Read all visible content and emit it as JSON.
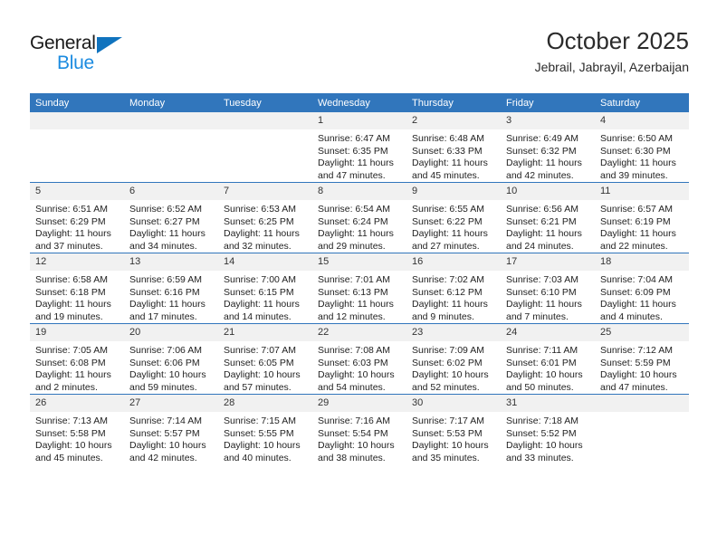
{
  "brand": {
    "name_part1": "General",
    "name_part2": "Blue",
    "accent_color": "#1073BE",
    "blue_text_color": "#1B8BE0"
  },
  "header": {
    "title": "October 2025",
    "subtitle": "Jebrail, Jabrayil, Azerbaijan"
  },
  "theme": {
    "header_blue": "#3176BC",
    "daynum_band": "#F1F1F1"
  },
  "weekdays": [
    "Sunday",
    "Monday",
    "Tuesday",
    "Wednesday",
    "Thursday",
    "Friday",
    "Saturday"
  ],
  "weeks": [
    [
      {
        "day": "",
        "sunrise": "",
        "sunset": "",
        "daylight1": "",
        "daylight2": ""
      },
      {
        "day": "",
        "sunrise": "",
        "sunset": "",
        "daylight1": "",
        "daylight2": ""
      },
      {
        "day": "",
        "sunrise": "",
        "sunset": "",
        "daylight1": "",
        "daylight2": ""
      },
      {
        "day": "1",
        "sunrise": "Sunrise: 6:47 AM",
        "sunset": "Sunset: 6:35 PM",
        "daylight1": "Daylight: 11 hours",
        "daylight2": "and 47 minutes."
      },
      {
        "day": "2",
        "sunrise": "Sunrise: 6:48 AM",
        "sunset": "Sunset: 6:33 PM",
        "daylight1": "Daylight: 11 hours",
        "daylight2": "and 45 minutes."
      },
      {
        "day": "3",
        "sunrise": "Sunrise: 6:49 AM",
        "sunset": "Sunset: 6:32 PM",
        "daylight1": "Daylight: 11 hours",
        "daylight2": "and 42 minutes."
      },
      {
        "day": "4",
        "sunrise": "Sunrise: 6:50 AM",
        "sunset": "Sunset: 6:30 PM",
        "daylight1": "Daylight: 11 hours",
        "daylight2": "and 39 minutes."
      }
    ],
    [
      {
        "day": "5",
        "sunrise": "Sunrise: 6:51 AM",
        "sunset": "Sunset: 6:29 PM",
        "daylight1": "Daylight: 11 hours",
        "daylight2": "and 37 minutes."
      },
      {
        "day": "6",
        "sunrise": "Sunrise: 6:52 AM",
        "sunset": "Sunset: 6:27 PM",
        "daylight1": "Daylight: 11 hours",
        "daylight2": "and 34 minutes."
      },
      {
        "day": "7",
        "sunrise": "Sunrise: 6:53 AM",
        "sunset": "Sunset: 6:25 PM",
        "daylight1": "Daylight: 11 hours",
        "daylight2": "and 32 minutes."
      },
      {
        "day": "8",
        "sunrise": "Sunrise: 6:54 AM",
        "sunset": "Sunset: 6:24 PM",
        "daylight1": "Daylight: 11 hours",
        "daylight2": "and 29 minutes."
      },
      {
        "day": "9",
        "sunrise": "Sunrise: 6:55 AM",
        "sunset": "Sunset: 6:22 PM",
        "daylight1": "Daylight: 11 hours",
        "daylight2": "and 27 minutes."
      },
      {
        "day": "10",
        "sunrise": "Sunrise: 6:56 AM",
        "sunset": "Sunset: 6:21 PM",
        "daylight1": "Daylight: 11 hours",
        "daylight2": "and 24 minutes."
      },
      {
        "day": "11",
        "sunrise": "Sunrise: 6:57 AM",
        "sunset": "Sunset: 6:19 PM",
        "daylight1": "Daylight: 11 hours",
        "daylight2": "and 22 minutes."
      }
    ],
    [
      {
        "day": "12",
        "sunrise": "Sunrise: 6:58 AM",
        "sunset": "Sunset: 6:18 PM",
        "daylight1": "Daylight: 11 hours",
        "daylight2": "and 19 minutes."
      },
      {
        "day": "13",
        "sunrise": "Sunrise: 6:59 AM",
        "sunset": "Sunset: 6:16 PM",
        "daylight1": "Daylight: 11 hours",
        "daylight2": "and 17 minutes."
      },
      {
        "day": "14",
        "sunrise": "Sunrise: 7:00 AM",
        "sunset": "Sunset: 6:15 PM",
        "daylight1": "Daylight: 11 hours",
        "daylight2": "and 14 minutes."
      },
      {
        "day": "15",
        "sunrise": "Sunrise: 7:01 AM",
        "sunset": "Sunset: 6:13 PM",
        "daylight1": "Daylight: 11 hours",
        "daylight2": "and 12 minutes."
      },
      {
        "day": "16",
        "sunrise": "Sunrise: 7:02 AM",
        "sunset": "Sunset: 6:12 PM",
        "daylight1": "Daylight: 11 hours",
        "daylight2": "and 9 minutes."
      },
      {
        "day": "17",
        "sunrise": "Sunrise: 7:03 AM",
        "sunset": "Sunset: 6:10 PM",
        "daylight1": "Daylight: 11 hours",
        "daylight2": "and 7 minutes."
      },
      {
        "day": "18",
        "sunrise": "Sunrise: 7:04 AM",
        "sunset": "Sunset: 6:09 PM",
        "daylight1": "Daylight: 11 hours",
        "daylight2": "and 4 minutes."
      }
    ],
    [
      {
        "day": "19",
        "sunrise": "Sunrise: 7:05 AM",
        "sunset": "Sunset: 6:08 PM",
        "daylight1": "Daylight: 11 hours",
        "daylight2": "and 2 minutes."
      },
      {
        "day": "20",
        "sunrise": "Sunrise: 7:06 AM",
        "sunset": "Sunset: 6:06 PM",
        "daylight1": "Daylight: 10 hours",
        "daylight2": "and 59 minutes."
      },
      {
        "day": "21",
        "sunrise": "Sunrise: 7:07 AM",
        "sunset": "Sunset: 6:05 PM",
        "daylight1": "Daylight: 10 hours",
        "daylight2": "and 57 minutes."
      },
      {
        "day": "22",
        "sunrise": "Sunrise: 7:08 AM",
        "sunset": "Sunset: 6:03 PM",
        "daylight1": "Daylight: 10 hours",
        "daylight2": "and 54 minutes."
      },
      {
        "day": "23",
        "sunrise": "Sunrise: 7:09 AM",
        "sunset": "Sunset: 6:02 PM",
        "daylight1": "Daylight: 10 hours",
        "daylight2": "and 52 minutes."
      },
      {
        "day": "24",
        "sunrise": "Sunrise: 7:11 AM",
        "sunset": "Sunset: 6:01 PM",
        "daylight1": "Daylight: 10 hours",
        "daylight2": "and 50 minutes."
      },
      {
        "day": "25",
        "sunrise": "Sunrise: 7:12 AM",
        "sunset": "Sunset: 5:59 PM",
        "daylight1": "Daylight: 10 hours",
        "daylight2": "and 47 minutes."
      }
    ],
    [
      {
        "day": "26",
        "sunrise": "Sunrise: 7:13 AM",
        "sunset": "Sunset: 5:58 PM",
        "daylight1": "Daylight: 10 hours",
        "daylight2": "and 45 minutes."
      },
      {
        "day": "27",
        "sunrise": "Sunrise: 7:14 AM",
        "sunset": "Sunset: 5:57 PM",
        "daylight1": "Daylight: 10 hours",
        "daylight2": "and 42 minutes."
      },
      {
        "day": "28",
        "sunrise": "Sunrise: 7:15 AM",
        "sunset": "Sunset: 5:55 PM",
        "daylight1": "Daylight: 10 hours",
        "daylight2": "and 40 minutes."
      },
      {
        "day": "29",
        "sunrise": "Sunrise: 7:16 AM",
        "sunset": "Sunset: 5:54 PM",
        "daylight1": "Daylight: 10 hours",
        "daylight2": "and 38 minutes."
      },
      {
        "day": "30",
        "sunrise": "Sunrise: 7:17 AM",
        "sunset": "Sunset: 5:53 PM",
        "daylight1": "Daylight: 10 hours",
        "daylight2": "and 35 minutes."
      },
      {
        "day": "31",
        "sunrise": "Sunrise: 7:18 AM",
        "sunset": "Sunset: 5:52 PM",
        "daylight1": "Daylight: 10 hours",
        "daylight2": "and 33 minutes."
      },
      {
        "day": "",
        "sunrise": "",
        "sunset": "",
        "daylight1": "",
        "daylight2": ""
      }
    ]
  ]
}
